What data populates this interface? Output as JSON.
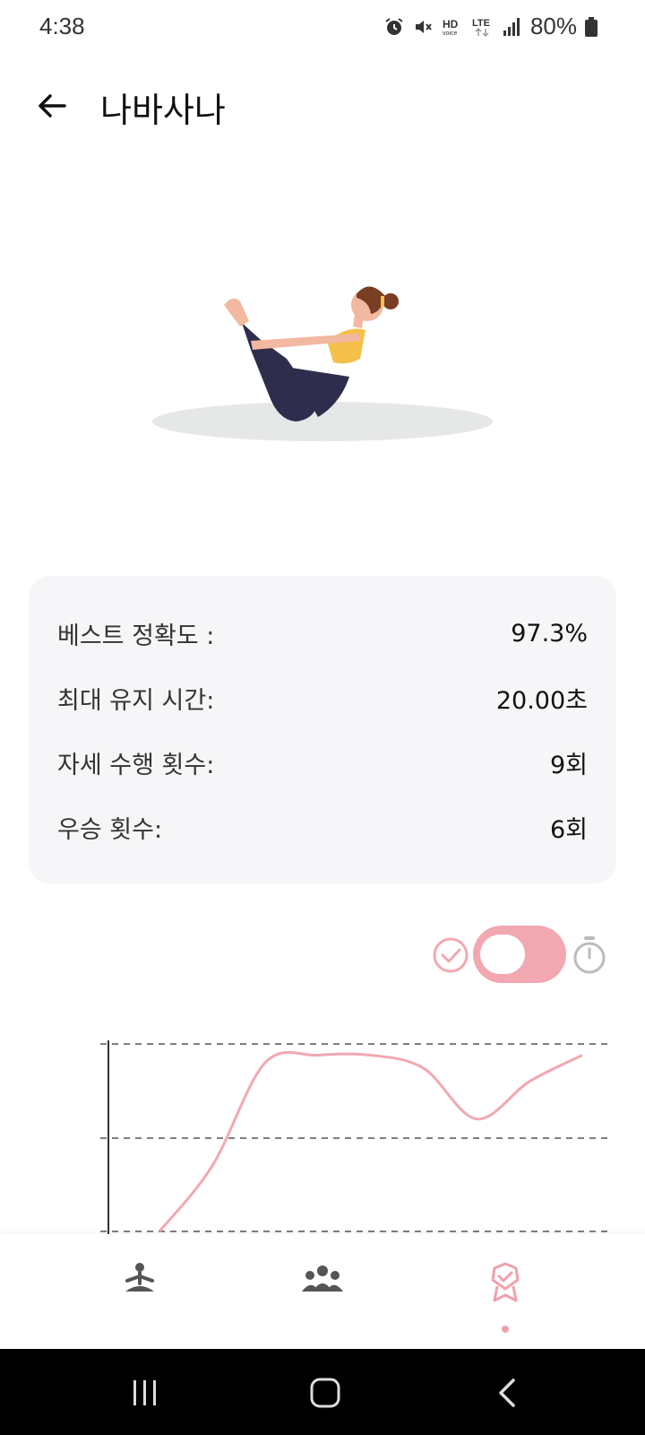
{
  "status_bar": {
    "time": "4:38",
    "battery": "80%",
    "icons": [
      "alarm-icon",
      "mute-icon",
      "hd-voice-icon",
      "lte-icon",
      "signal-icon",
      "battery-icon"
    ]
  },
  "header": {
    "title": "나바사나",
    "back_icon": "arrow-left-icon"
  },
  "stats": {
    "best_accuracy_label": "베스트 정확도 :",
    "best_accuracy_value": "97.3%",
    "max_hold_label": "최대 유지 시간:",
    "max_hold_value": "20.00초",
    "attempts_label": "자세 수행 횟수:",
    "attempts_value": "9회",
    "wins_label": "우승 횟수:",
    "wins_value": "6회"
  },
  "toggle": {
    "left_icon": "check-circle-icon",
    "right_icon": "stopwatch-icon",
    "state": "left"
  },
  "colors": {
    "accent": "#f2a8b0",
    "card_bg": "#f6f6f9",
    "nav_inactive": "#555555"
  },
  "chart_data": {
    "type": "line",
    "grid": "dashed horizontal",
    "series": [
      {
        "values": [
          0.0,
          0.35,
          0.9,
          0.94,
          0.94,
          0.87,
          0.6,
          0.8,
          0.94
        ]
      }
    ]
  },
  "bottom_nav": {
    "items": [
      {
        "icon": "yoga-pose-icon",
        "active": false
      },
      {
        "icon": "group-icon",
        "active": false
      },
      {
        "icon": "award-badge-icon",
        "active": true
      }
    ]
  },
  "system_nav": {
    "buttons": [
      "recents-icon",
      "home-icon",
      "back-icon"
    ]
  }
}
